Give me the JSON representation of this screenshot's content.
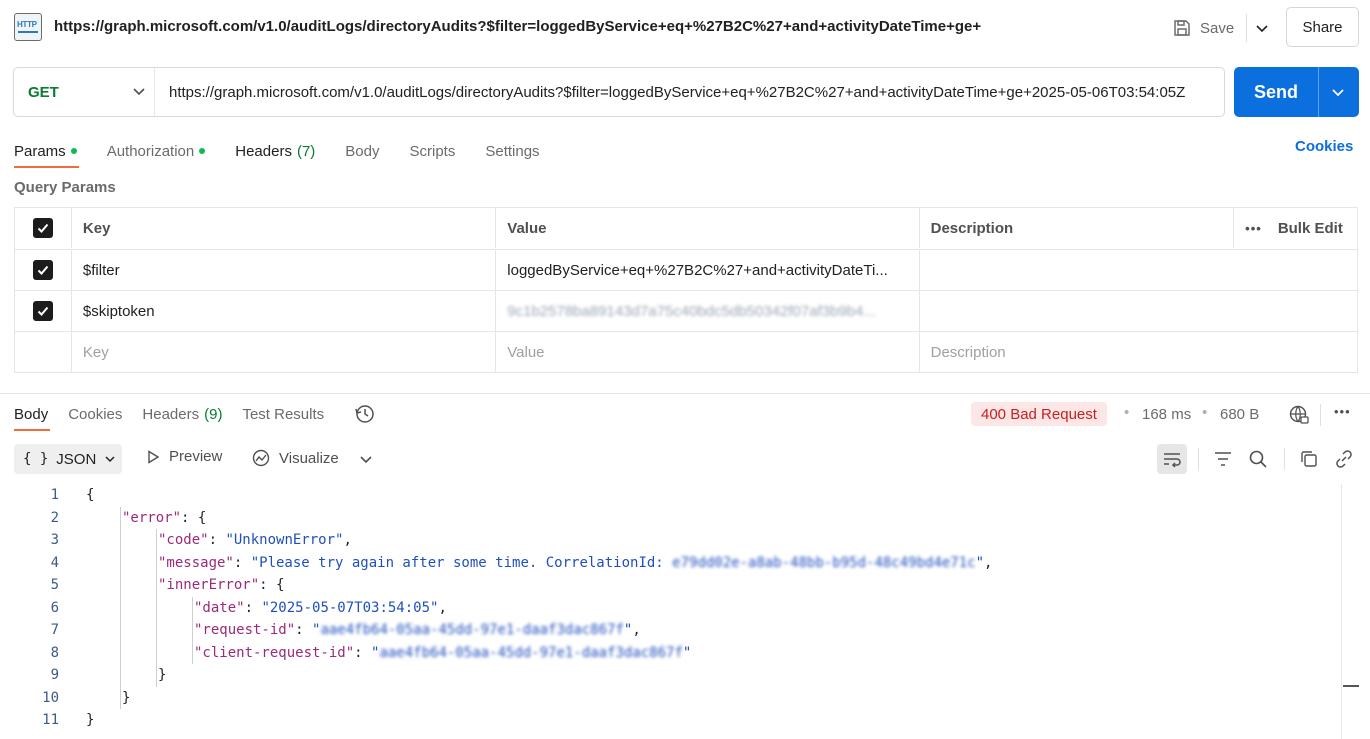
{
  "titlebar": {
    "icon_label": "HTTP",
    "title": "https://graph.microsoft.com/v1.0/auditLogs/directoryAudits?$filter=loggedByService+eq+%27B2C%27+and+activityDateTime+ge+",
    "save_label": "Save",
    "share_label": "Share"
  },
  "request": {
    "method": "GET",
    "url": "https://graph.microsoft.com/v1.0/auditLogs/directoryAudits?$filter=loggedByService+eq+%27B2C%27+and+activityDateTime+ge+2025-05-06T03:54:05Z",
    "send_label": "Send"
  },
  "request_tabs": [
    {
      "label": "Params",
      "dot": true,
      "count": ""
    },
    {
      "label": "Authorization",
      "dot": true,
      "count": ""
    },
    {
      "label": "Headers",
      "dot": false,
      "count": "(7)"
    },
    {
      "label": "Body",
      "dot": false,
      "count": ""
    },
    {
      "label": "Scripts",
      "dot": false,
      "count": ""
    },
    {
      "label": "Settings",
      "dot": false,
      "count": ""
    }
  ],
  "cookies_label": "Cookies",
  "query_params": {
    "title": "Query Params",
    "headers": {
      "key": "Key",
      "value": "Value",
      "description": "Description",
      "bulk_edit": "Bulk Edit"
    },
    "rows": [
      {
        "checked": true,
        "key": "$filter",
        "value": "loggedByService+eq+%27B2C%27+and+activityDateTi...",
        "description": ""
      },
      {
        "checked": true,
        "key": "$skiptoken",
        "value": "9c1b2578ba89143d7a75c40bdc5db50342f07af3b9b4...",
        "description": ""
      }
    ],
    "placeholders": {
      "key": "Key",
      "value": "Value",
      "description": "Description"
    }
  },
  "response_tabs": [
    {
      "label": "Body",
      "count": ""
    },
    {
      "label": "Cookies",
      "count": ""
    },
    {
      "label": "Headers",
      "count": "(9)"
    },
    {
      "label": "Test Results",
      "count": ""
    }
  ],
  "response_meta": {
    "status": "400 Bad Request",
    "time": "168 ms",
    "size": "680 B",
    "status_color": "#c61f1f"
  },
  "body_toolbar": {
    "format": "JSON",
    "preview": "Preview",
    "visualize": "Visualize"
  },
  "code_lines": [
    {
      "n": "1",
      "indent": 0,
      "parts": [
        [
          "p",
          "{"
        ]
      ]
    },
    {
      "n": "2",
      "indent": 1,
      "parts": [
        [
          "k",
          "\"error\""
        ],
        [
          "p",
          ": {"
        ]
      ]
    },
    {
      "n": "3",
      "indent": 2,
      "parts": [
        [
          "k",
          "\"code\""
        ],
        [
          "p",
          ": "
        ],
        [
          "s",
          "\"UnknownError\""
        ],
        [
          "p",
          ","
        ]
      ]
    },
    {
      "n": "4",
      "indent": 2,
      "parts": [
        [
          "k",
          "\"message\""
        ],
        [
          "p",
          ": "
        ],
        [
          "s",
          "\"Please try again after some time. CorrelationId: "
        ],
        [
          "b",
          "e79dd02e-a8ab-48bb-b95d-48c49bd4e71c"
        ],
        [
          "s",
          "\""
        ],
        [
          "p",
          ","
        ]
      ]
    },
    {
      "n": "5",
      "indent": 2,
      "parts": [
        [
          "k",
          "\"innerError\""
        ],
        [
          "p",
          ": {"
        ]
      ]
    },
    {
      "n": "6",
      "indent": 3,
      "parts": [
        [
          "k",
          "\"date\""
        ],
        [
          "p",
          ": "
        ],
        [
          "s",
          "\"2025-05-07T03:54:05\""
        ],
        [
          "p",
          ","
        ]
      ]
    },
    {
      "n": "7",
      "indent": 3,
      "parts": [
        [
          "k",
          "\"request-id\""
        ],
        [
          "p",
          ": "
        ],
        [
          "s",
          "\""
        ],
        [
          "b",
          "aae4fb64-05aa-45dd-97e1-daaf3dac867f"
        ],
        [
          "s",
          "\""
        ],
        [
          "p",
          ","
        ]
      ]
    },
    {
      "n": "8",
      "indent": 3,
      "parts": [
        [
          "k",
          "\"client-request-id\""
        ],
        [
          "p",
          ": "
        ],
        [
          "s",
          "\""
        ],
        [
          "b",
          "aae4fb64-05aa-45dd-97e1-daaf3dac867f"
        ],
        [
          "s",
          "\""
        ]
      ]
    },
    {
      "n": "9",
      "indent": 2,
      "parts": [
        [
          "p",
          "}"
        ]
      ]
    },
    {
      "n": "10",
      "indent": 1,
      "parts": [
        [
          "p",
          "}"
        ]
      ]
    },
    {
      "n": "11",
      "indent": 0,
      "parts": [
        [
          "p",
          "}"
        ]
      ]
    }
  ]
}
